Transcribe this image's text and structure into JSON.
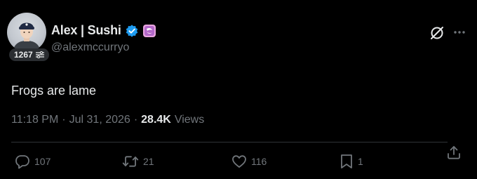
{
  "author": {
    "display_name": "Alex | Sushi",
    "handle": "@alexmccurryo",
    "badge_count": "1267",
    "avatar_icon": "avatar-image",
    "verified_icon": "verified-badge-icon",
    "affiliate_icon": "affiliate-badge-icon"
  },
  "tweet": {
    "text": "Frogs are lame",
    "time": "11:18 PM",
    "separator": "·",
    "date": "Jul 31, 2026",
    "views_count": "28.4K",
    "views_label": "Views"
  },
  "actions": {
    "replies": "107",
    "retweets": "21",
    "likes": "116",
    "bookmarks": "1"
  },
  "colors": {
    "background": "#000000",
    "primary_text": "#e7e9ea",
    "secondary_text": "#71767b",
    "verified_blue": "#1d9bf0",
    "affiliate_pink": "#e8a0d8",
    "divider": "#2f3336"
  }
}
